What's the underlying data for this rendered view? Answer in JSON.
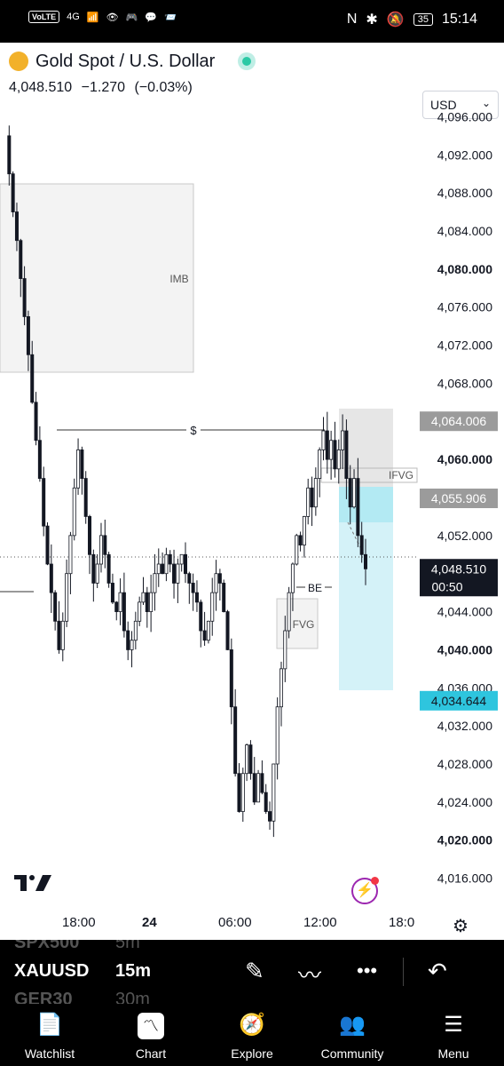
{
  "status_bar": {
    "left": [
      "VoLTE",
      "4G",
      "📶",
      "👁",
      "🎮",
      "💬",
      "📨"
    ],
    "nfc": "N",
    "battery": "35",
    "time": "15:14"
  },
  "header": {
    "title": "Gold Spot / U.S. Dollar",
    "price": "4,048.510",
    "change": "−1.270",
    "change_pct": "(−0.03%)",
    "currency": "USD"
  },
  "chart_data": {
    "type": "candlestick",
    "symbol": "XAUUSD",
    "interval": "15m",
    "ylim": [
      4014,
      4098
    ],
    "y_ticks": [
      "4,096.000",
      "4,092.000",
      "4,088.000",
      "4,084.000",
      "4,080.000",
      "4,076.000",
      "4,072.000",
      "4,068.000",
      "4,064.000",
      "4,060.000",
      "4,056.000",
      "4,052.000",
      "4,048.000",
      "4,044.000",
      "4,040.000",
      "4,036.000",
      "4,032.000",
      "4,028.000",
      "4,024.000",
      "4,020.000",
      "4,016.000"
    ],
    "bold_ticks": [
      "4,080.000",
      "4,060.000",
      "4,040.000",
      "4,020.000"
    ],
    "x_ticks": [
      {
        "label": "18:00",
        "x": 0.17
      },
      {
        "label": "24",
        "x": 0.3,
        "bold": true
      },
      {
        "label": "06:00",
        "x": 0.47
      },
      {
        "label": "12:00",
        "x": 0.64
      },
      {
        "label": "18:0",
        "x": 0.8
      }
    ],
    "price_labels": [
      {
        "value": "4,064.006",
        "style": "grey"
      },
      {
        "value": "4,055.906",
        "style": "grey"
      },
      {
        "value": "4,048.510",
        "sub": "00:50",
        "style": "dark"
      },
      {
        "value": "4,034.644",
        "style": "cyan"
      }
    ],
    "annotations": [
      {
        "label": "IMB",
        "kind": "zone"
      },
      {
        "label": "$",
        "kind": "line",
        "price": 4062.5
      },
      {
        "label": "IFVG",
        "kind": "zone"
      },
      {
        "label": "BE",
        "kind": "line",
        "price": 4045.2
      },
      {
        "label": "FVG",
        "kind": "zone"
      }
    ],
    "position": {
      "entry": 4055.9,
      "stop": 4064.0,
      "target": 4034.6
    },
    "last_price": 4048.51,
    "price_path": [
      4094,
      4090,
      4086,
      4083,
      4079,
      4075,
      4071,
      4066,
      4062,
      4058,
      4053,
      4049,
      4046,
      4043,
      4040,
      4043,
      4048,
      4052,
      4057,
      4061,
      4058,
      4054,
      4050,
      4047,
      4049,
      4052,
      4050,
      4047,
      4045,
      4044,
      4046,
      4042,
      4040,
      4041,
      4043,
      4045,
      4046,
      4044,
      4046,
      4048,
      4049,
      4048,
      4050,
      4049,
      4047,
      4049,
      4050,
      4048,
      4047,
      4046,
      4045,
      4042,
      4041,
      4043,
      4046,
      4048,
      4047,
      4044,
      4040,
      4034,
      4027,
      4023,
      4027,
      4030,
      4027,
      4024,
      4027,
      4025,
      4023,
      4022,
      4028,
      4034,
      4038,
      4042,
      4046,
      4049,
      4052,
      4051,
      4054,
      4057,
      4055,
      4058,
      4061,
      4063,
      4060,
      4062,
      4059,
      4061,
      4063,
      4058,
      4055,
      4058,
      4052,
      4050,
      4048.5
    ]
  },
  "branding": {
    "logo": "17"
  },
  "toolbar": {
    "ghost_top_symbol": "SPX500",
    "ghost_top_interval": "5m",
    "symbol": "XAUUSD",
    "interval": "15m",
    "ghost_bottom_symbol": "GER30",
    "ghost_bottom_interval": "30m"
  },
  "nav": [
    {
      "label": "Watchlist",
      "icon": "watchlist-icon"
    },
    {
      "label": "Chart",
      "icon": "chart-icon"
    },
    {
      "label": "Explore",
      "icon": "compass-icon"
    },
    {
      "label": "Community",
      "icon": "people-icon"
    },
    {
      "label": "Menu",
      "icon": "menu-icon"
    }
  ]
}
